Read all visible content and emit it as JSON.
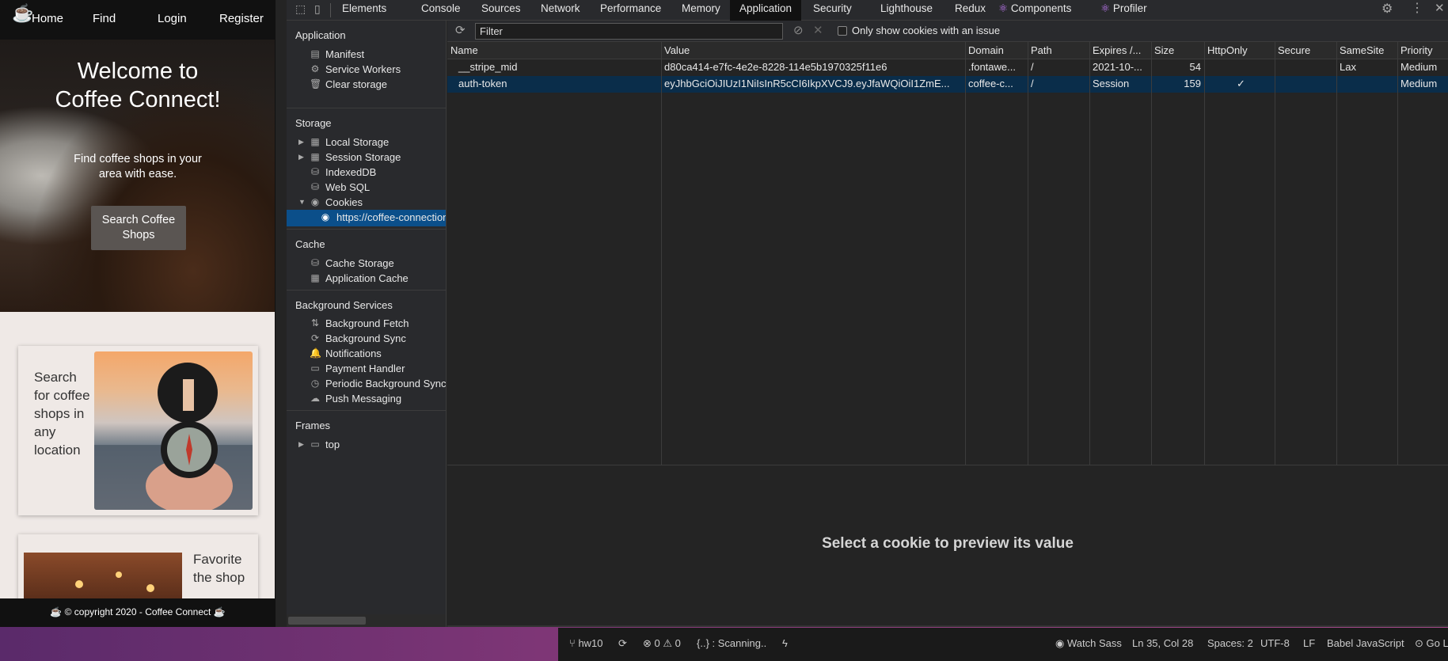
{
  "site": {
    "nav": {
      "home": "Home",
      "find": "Find",
      "login": "Login",
      "register": "Register"
    },
    "hero": {
      "title": "Welcome to Coffee Connect!",
      "subtitle": "Find coffee shops in your area with ease.",
      "button": "Search Coffee Shops"
    },
    "cards": [
      {
        "text": "Search for coffee shops in any location"
      },
      {
        "text": "Favorite the shop"
      }
    ],
    "footer": "☕ © copyright 2020 - Coffee Connect ☕"
  },
  "devtools": {
    "tabs": [
      "Elements",
      "Console",
      "Sources",
      "Network",
      "Performance",
      "Memory",
      "Application",
      "Security",
      "Lighthouse",
      "Redux",
      "Components",
      "Profiler"
    ],
    "active_tab": "Application",
    "sidebar": {
      "application_title": "Application",
      "application_items": [
        "Manifest",
        "Service Workers",
        "Clear storage"
      ],
      "storage_title": "Storage",
      "storage_items": [
        "Local Storage",
        "Session Storage",
        "IndexedDB",
        "Web SQL",
        "Cookies"
      ],
      "cookie_origin": "https://coffee-connection",
      "cache_title": "Cache",
      "cache_items": [
        "Cache Storage",
        "Application Cache"
      ],
      "background_title": "Background Services",
      "background_items": [
        "Background Fetch",
        "Background Sync",
        "Notifications",
        "Payment Handler",
        "Periodic Background Sync",
        "Push Messaging"
      ],
      "frames_title": "Frames",
      "frames_items": [
        "top"
      ]
    },
    "filter": {
      "placeholder": "Filter",
      "only_issues_label": "Only show cookies with an issue"
    },
    "table": {
      "columns": [
        "Name",
        "Value",
        "Domain",
        "Path",
        "Expires /...",
        "Size",
        "HttpOnly",
        "Secure",
        "SameSite",
        "Priority"
      ],
      "rows": [
        {
          "name": "__stripe_mid",
          "value": "d80ca414-e7fc-4e2e-8228-114e5b1970325f11e6",
          "domain": ".fontawe...",
          "path": "/",
          "expires": "2021-10-...",
          "size": "54",
          "httponly": "",
          "secure": "",
          "samesite": "Lax",
          "priority": "Medium"
        },
        {
          "name": "auth-token",
          "value": "eyJhbGciOiJIUzI1NiIsInR5cCI6IkpXVCJ9.eyJfaWQiOiI1ZmE...",
          "domain": "coffee-c...",
          "path": "/",
          "expires": "Session",
          "size": "159",
          "httponly": "✓",
          "secure": "",
          "samesite": "",
          "priority": "Medium"
        }
      ]
    },
    "preview_message": "Select a cookie to preview its value"
  },
  "statusbar": {
    "branch": "hw10",
    "problems": "⊗ 0 ⚠ 0",
    "scanning": "{..} : Scanning..",
    "watch": "Watch Sass",
    "position": "Ln 35, Col 28",
    "spaces": "Spaces: 2",
    "encoding": "UTF-8",
    "eol": "LF",
    "language": "Babel JavaScript",
    "golive": "Go Live"
  }
}
